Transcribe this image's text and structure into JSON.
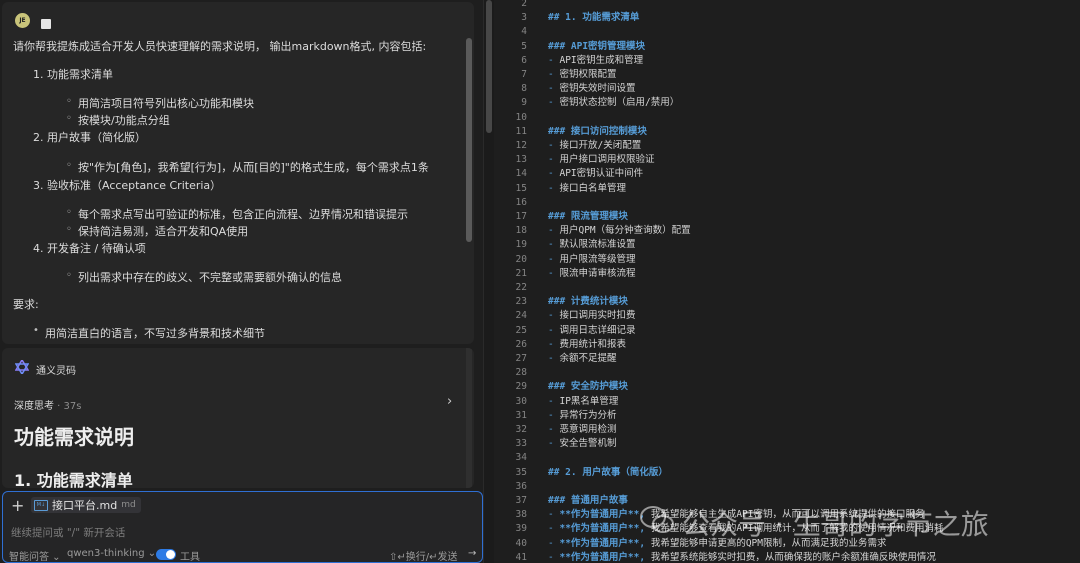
{
  "user_message": {
    "avatar_text": "JE",
    "intro": "请你帮我提炼成适合开发人员快速理解的需求说明， 输出markdown格式, 内容包括:",
    "sections": [
      {
        "title": "1. 功能需求清单",
        "items": [
          "用简洁项目符号列出核心功能和模块",
          "按模块/功能点分组"
        ]
      },
      {
        "title": "2. 用户故事（简化版）",
        "items": [
          "按\"作为[角色]，我希望[行为]，从而[目的]\"的格式生成，每个需求点1条"
        ]
      },
      {
        "title": "3. 验收标准（Acceptance Criteria）",
        "items": [
          "每个需求点写出可验证的标准，包含正向流程、边界情况和错误提示",
          "保持简洁易测，适合开发和QA使用"
        ]
      },
      {
        "title": "4. 开发备注 / 待确认项",
        "items": [
          "列出需求中存在的歧义、不完整或需要额外确认的信息"
        ]
      }
    ],
    "requirements_label": "要求:",
    "requirements": [
      "用简洁直白的语言，不写过多背景和技术细节"
    ]
  },
  "assistant": {
    "name": "通义灵码",
    "thinking_label": "深度思考",
    "thinking_time": " · 37s",
    "heading1": "功能需求说明",
    "heading2": "1. 功能需求清单"
  },
  "input": {
    "file_name": "接口平台.md",
    "file_ext": "md",
    "placeholder": "继续提问或 \"/\" 新开会话",
    "mode": "智能问答",
    "model": "qwen3-thinking",
    "tools_label": "工具",
    "hint": "⇧↵换行/↵发送",
    "send_icon": "→"
  },
  "editor": {
    "lines": [
      {
        "n": "2",
        "text": ""
      },
      {
        "n": "3",
        "text": "## 1. 功能需求清单",
        "type": "head"
      },
      {
        "n": "4",
        "text": ""
      },
      {
        "n": "5",
        "text": "### API密钥管理模块",
        "type": "head"
      },
      {
        "n": "6",
        "text": "API密钥生成和管理",
        "type": "item"
      },
      {
        "n": "7",
        "text": "密钥权限配置",
        "type": "item"
      },
      {
        "n": "8",
        "text": "密钥失效时间设置",
        "type": "item"
      },
      {
        "n": "9",
        "text": "密钥状态控制（启用/禁用）",
        "type": "item"
      },
      {
        "n": "10",
        "text": ""
      },
      {
        "n": "11",
        "text": "### 接口访问控制模块",
        "type": "head"
      },
      {
        "n": "12",
        "text": "接口开放/关闭配置",
        "type": "item"
      },
      {
        "n": "13",
        "text": "用户接口调用权限验证",
        "type": "item"
      },
      {
        "n": "14",
        "text": "API密钥认证中间件",
        "type": "item"
      },
      {
        "n": "15",
        "text": "接口白名单管理",
        "type": "item"
      },
      {
        "n": "16",
        "text": ""
      },
      {
        "n": "17",
        "text": "### 限流管理模块",
        "type": "head"
      },
      {
        "n": "18",
        "text": "用户QPM（每分钟查询数）配置",
        "type": "item"
      },
      {
        "n": "19",
        "text": "默认限流标准设置",
        "type": "item"
      },
      {
        "n": "20",
        "text": "用户限流等级管理",
        "type": "item"
      },
      {
        "n": "21",
        "text": "限流申请审核流程",
        "type": "item"
      },
      {
        "n": "22",
        "text": ""
      },
      {
        "n": "23",
        "text": "### 计费统计模块",
        "type": "head"
      },
      {
        "n": "24",
        "text": "接口调用实时扣费",
        "type": "item"
      },
      {
        "n": "25",
        "text": "调用日志详细记录",
        "type": "item"
      },
      {
        "n": "26",
        "text": "费用统计和报表",
        "type": "item"
      },
      {
        "n": "27",
        "text": "余额不足提醒",
        "type": "item"
      },
      {
        "n": "28",
        "text": ""
      },
      {
        "n": "29",
        "text": "### 安全防护模块",
        "type": "head"
      },
      {
        "n": "30",
        "text": "IP黑名单管理",
        "type": "item"
      },
      {
        "n": "31",
        "text": "异常行为分析",
        "type": "item"
      },
      {
        "n": "32",
        "text": "恶意调用检测",
        "type": "item"
      },
      {
        "n": "33",
        "text": "安全告警机制",
        "type": "item"
      },
      {
        "n": "34",
        "text": ""
      },
      {
        "n": "35",
        "text": "## 2. 用户故事（简化版）",
        "type": "head"
      },
      {
        "n": "36",
        "text": ""
      },
      {
        "n": "37",
        "text": "### 普通用户故事",
        "type": "head"
      },
      {
        "n": "38",
        "text": "我希望能够自主生成API密钥，从而可以调用系统提供的接口服务",
        "type": "story"
      },
      {
        "n": "39",
        "text": "我希望能够查看我的API调用统计，从而了解我的使用情况和费用消耗",
        "type": "story"
      },
      {
        "n": "40",
        "text": "我希望能够申请更高的QPM限制，从而满足我的业务需求",
        "type": "story"
      },
      {
        "n": "41",
        "text": "我希望系统能够实时扣费，从而确保我的账户余额准确反映使用情况",
        "type": "story"
      }
    ],
    "bullet": "-",
    "story_prefix": "**作为普通用户**,"
  },
  "watermark": {
    "text": "公众号 · 生哥的字节之旅"
  }
}
